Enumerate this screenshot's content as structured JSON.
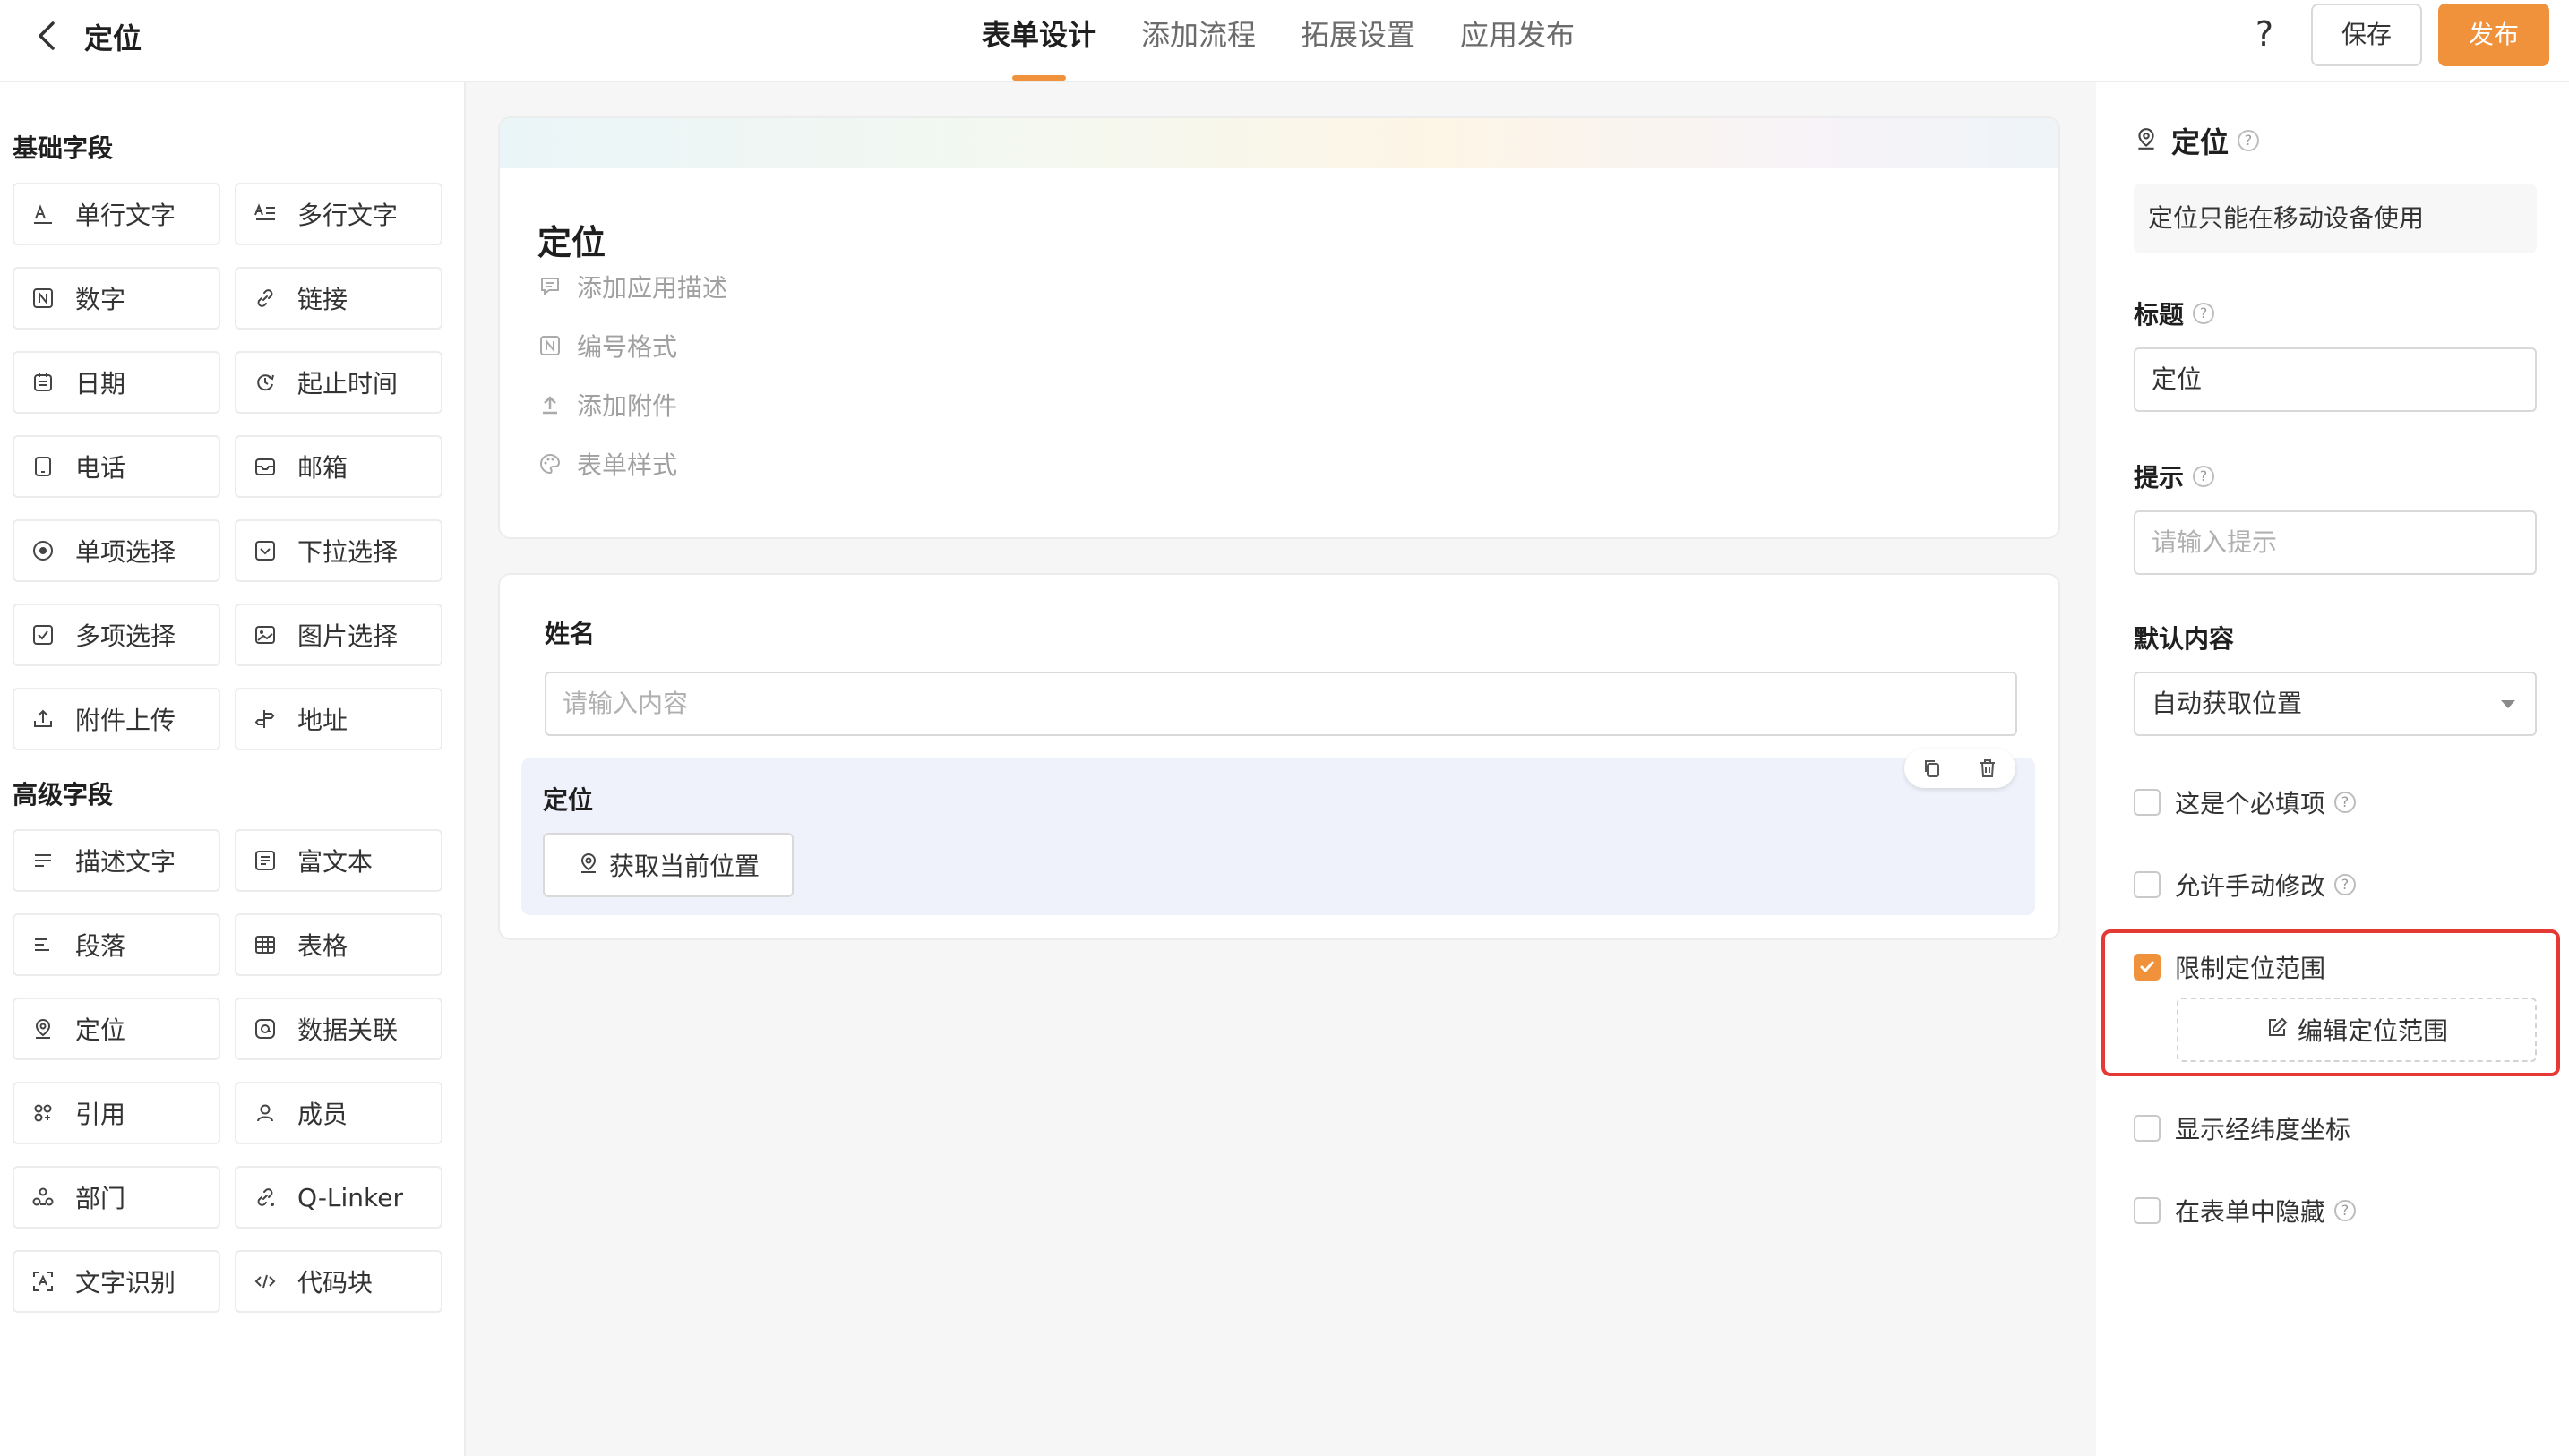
{
  "header": {
    "title": "定位",
    "tabs": [
      {
        "label": "表单设计",
        "active": true
      },
      {
        "label": "添加流程",
        "active": false
      },
      {
        "label": "拓展设置",
        "active": false
      },
      {
        "label": "应用发布",
        "active": false
      }
    ],
    "help_label": "?",
    "save_label": "保存",
    "publish_label": "发布"
  },
  "left": {
    "basic_title": "基础字段",
    "advanced_title": "高级字段",
    "basic_fields": [
      {
        "label": "单行文字",
        "icon": "single-line-text-icon"
      },
      {
        "label": "多行文字",
        "icon": "multi-line-text-icon"
      },
      {
        "label": "数字",
        "icon": "number-icon"
      },
      {
        "label": "链接",
        "icon": "link-icon"
      },
      {
        "label": "日期",
        "icon": "calendar-icon"
      },
      {
        "label": "起止时间",
        "icon": "time-range-icon"
      },
      {
        "label": "电话",
        "icon": "phone-icon"
      },
      {
        "label": "邮箱",
        "icon": "mail-icon"
      },
      {
        "label": "单项选择",
        "icon": "radio-icon"
      },
      {
        "label": "下拉选择",
        "icon": "dropdown-icon"
      },
      {
        "label": "多项选择",
        "icon": "checkbox-icon"
      },
      {
        "label": "图片选择",
        "icon": "image-icon"
      },
      {
        "label": "附件上传",
        "icon": "upload-icon"
      },
      {
        "label": "地址",
        "icon": "signpost-icon"
      }
    ],
    "advanced_fields": [
      {
        "label": "描述文字",
        "icon": "description-icon"
      },
      {
        "label": "富文本",
        "icon": "rich-text-icon"
      },
      {
        "label": "段落",
        "icon": "paragraph-icon"
      },
      {
        "label": "表格",
        "icon": "table-icon"
      },
      {
        "label": "定位",
        "icon": "location-icon"
      },
      {
        "label": "数据关联",
        "icon": "data-link-icon"
      },
      {
        "label": "引用",
        "icon": "reference-icon"
      },
      {
        "label": "成员",
        "icon": "member-icon"
      },
      {
        "label": "部门",
        "icon": "department-icon"
      },
      {
        "label": "Q-Linker",
        "icon": "q-linker-icon"
      },
      {
        "label": "文字识别",
        "icon": "ocr-icon"
      },
      {
        "label": "代码块",
        "icon": "code-icon"
      }
    ]
  },
  "form": {
    "title": "定位",
    "meta_items": [
      {
        "label": "添加应用描述",
        "icon": "comment-icon"
      },
      {
        "label": "编号格式",
        "icon": "number-format-icon"
      },
      {
        "label": "添加附件",
        "icon": "attachment-upload-icon"
      },
      {
        "label": "表单样式",
        "icon": "palette-icon"
      }
    ],
    "name_field": {
      "label": "姓名",
      "placeholder": "请输入内容"
    },
    "location_field": {
      "label": "定位",
      "button_label": "获取当前位置"
    }
  },
  "props": {
    "title": "定位",
    "notice": "定位只能在移动设备使用",
    "title_label": "标题",
    "title_value": "定位",
    "hint_label": "提示",
    "hint_placeholder": "请输入提示",
    "default_label": "默认内容",
    "default_value": "自动获取位置",
    "options": {
      "required": {
        "label": "这是个必填项",
        "checked": false
      },
      "manual_edit": {
        "label": "允许手动修改",
        "checked": false
      },
      "limit_range": {
        "label": "限制定位范围",
        "checked": true
      },
      "show_coords": {
        "label": "显示经纬度坐标",
        "checked": false
      },
      "hide_in_form": {
        "label": "在表单中隐藏",
        "checked": false
      }
    },
    "edit_range_label": "编辑定位范围"
  },
  "colors": {
    "accent": "#f0923c",
    "highlight_border": "#e53935"
  }
}
